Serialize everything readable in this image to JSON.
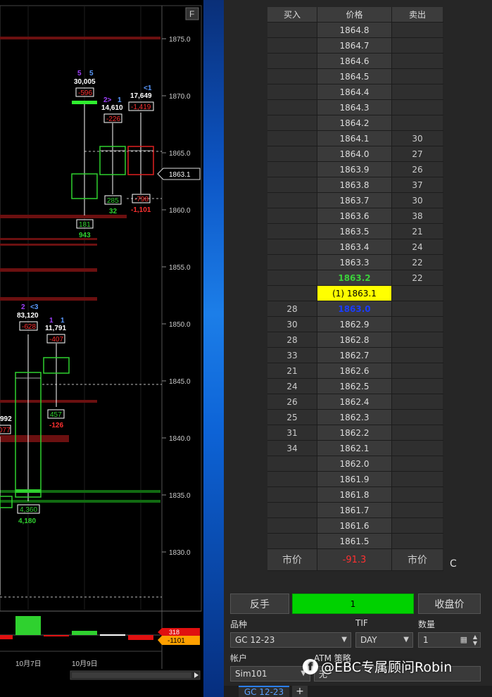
{
  "chart": {
    "corner_label": "F",
    "price_axis": [
      "1875.0",
      "1870.0",
      "1865.0",
      "1860.0",
      "1855.0",
      "1850.0",
      "1845.0",
      "1840.0",
      "1835.0",
      "1830.0"
    ],
    "current_price_tag": "1863.1",
    "date_labels": [
      "10月7日",
      "10月9日"
    ],
    "bottom_tags": [
      "318",
      "-1101"
    ],
    "candle_annotations": {
      "c1": {
        "top_a": "5",
        "top_b": "5",
        "volume": "30,005",
        "delta": "-596",
        "low_box": "181",
        "low_val": "943"
      },
      "c2": {
        "top_a": "2>",
        "top_b": "1",
        "volume": "14,610",
        "delta": "-226",
        "low_box": "285",
        "low_val": "32"
      },
      "c3": {
        "top_b": "<1",
        "volume": "17,649",
        "delta": "-1,419",
        "low_box": "-798",
        "low_val": "-1,101"
      },
      "c4": {
        "top_a": "2",
        "top_b": "<3",
        "volume": "83,120",
        "delta": "-628",
        "low_box": "4,360",
        "low_val": "4,180"
      },
      "c5": {
        "top_a": "1",
        "top_b": "1",
        "volume": "11,791",
        "delta": "-407",
        "low_box": "457",
        "low_val": "-126"
      },
      "c0": {
        "volume": "992",
        "delta": "077"
      }
    }
  },
  "dom": {
    "headers": {
      "buy": "买入",
      "price": "价格",
      "sell": "卖出"
    },
    "rows": [
      {
        "buy": "",
        "price": "1864.8",
        "sell": ""
      },
      {
        "buy": "",
        "price": "1864.7",
        "sell": ""
      },
      {
        "buy": "",
        "price": "1864.6",
        "sell": ""
      },
      {
        "buy": "",
        "price": "1864.5",
        "sell": ""
      },
      {
        "buy": "",
        "price": "1864.4",
        "sell": ""
      },
      {
        "buy": "",
        "price": "1864.3",
        "sell": ""
      },
      {
        "buy": "",
        "price": "1864.2",
        "sell": ""
      },
      {
        "buy": "",
        "price": "1864.1",
        "sell": "30"
      },
      {
        "buy": "",
        "price": "1864.0",
        "sell": "27"
      },
      {
        "buy": "",
        "price": "1863.9",
        "sell": "26"
      },
      {
        "buy": "",
        "price": "1863.8",
        "sell": "37"
      },
      {
        "buy": "",
        "price": "1863.7",
        "sell": "30"
      },
      {
        "buy": "",
        "price": "1863.6",
        "sell": "38"
      },
      {
        "buy": "",
        "price": "1863.5",
        "sell": "21"
      },
      {
        "buy": "",
        "price": "1863.4",
        "sell": "24"
      },
      {
        "buy": "",
        "price": "1863.3",
        "sell": "22"
      },
      {
        "buy": "",
        "price": "1863.2",
        "sell": "22",
        "style": "ask"
      },
      {
        "buy": "",
        "price": "(1) 1863.1",
        "sell": "",
        "style": "last"
      },
      {
        "buy": "28",
        "price": "1863.0",
        "sell": "",
        "style": "bid"
      },
      {
        "buy": "30",
        "price": "1862.9",
        "sell": ""
      },
      {
        "buy": "28",
        "price": "1862.8",
        "sell": ""
      },
      {
        "buy": "33",
        "price": "1862.7",
        "sell": ""
      },
      {
        "buy": "21",
        "price": "1862.6",
        "sell": ""
      },
      {
        "buy": "24",
        "price": "1862.5",
        "sell": ""
      },
      {
        "buy": "26",
        "price": "1862.4",
        "sell": ""
      },
      {
        "buy": "25",
        "price": "1862.3",
        "sell": ""
      },
      {
        "buy": "31",
        "price": "1862.2",
        "sell": ""
      },
      {
        "buy": "34",
        "price": "1862.1",
        "sell": ""
      },
      {
        "buy": "",
        "price": "1862.0",
        "sell": ""
      },
      {
        "buy": "",
        "price": "1861.9",
        "sell": ""
      },
      {
        "buy": "",
        "price": "1861.8",
        "sell": ""
      },
      {
        "buy": "",
        "price": "1861.7",
        "sell": ""
      },
      {
        "buy": "",
        "price": "1861.6",
        "sell": ""
      },
      {
        "buy": "",
        "price": "1861.5",
        "sell": ""
      }
    ],
    "market": {
      "buy": "市价",
      "pnl": "-91.3",
      "sell": "市价",
      "c_label": "C"
    },
    "reverse_button": "反手",
    "position_value": "1",
    "close_button": "收盘价",
    "instrument_label": "品种",
    "instrument_value": "GC 12-23",
    "tif_label": "TIF",
    "tif_value": "DAY",
    "qty_label": "数量",
    "qty_value": "1",
    "account_label": "帐户",
    "account_value": "Sim101",
    "atm_label": "ATM 策略",
    "atm_value": "无",
    "tab_label": "GC 12-23",
    "tab_add": "+"
  },
  "watermark": "@EBC专属顾问Robin",
  "colors": {
    "ask_green": "#3ad13a",
    "bid_blue": "#1a3cff",
    "last_yellow": "#ffff00",
    "position_green": "#00d200",
    "down_red": "#ff2020"
  }
}
